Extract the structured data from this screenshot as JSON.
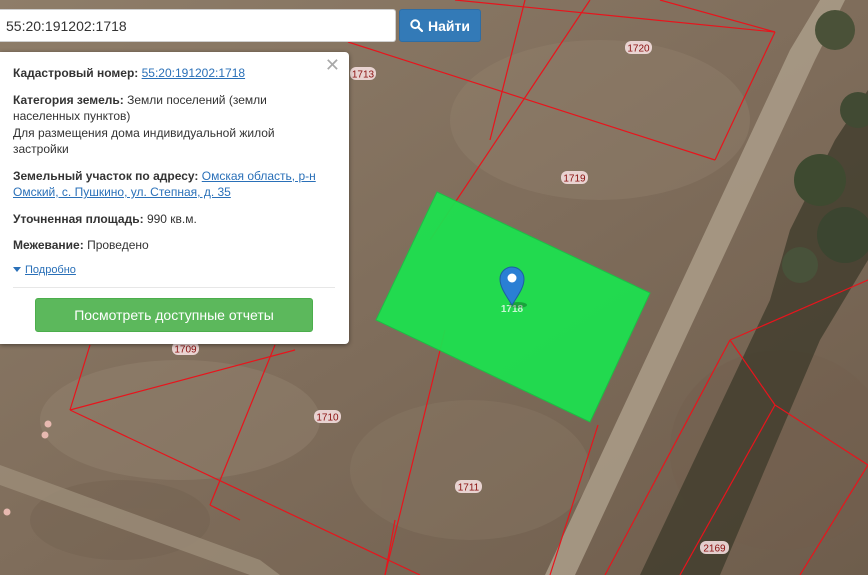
{
  "search": {
    "value": "55:20:191202:1718",
    "button_label": "Найти"
  },
  "popup": {
    "cadastral_label": "Кадастровый номер:",
    "cadastral_value": "55:20:191202:1718",
    "category_label": "Категория земель:",
    "category_value": "Земли поселений (земли населенных пунктов)",
    "category_use": "Для размещения дома индивидуальной жилой застройки",
    "address_label": "Земельный участок по адресу:",
    "address_value": "Омская область, р-н Омский, с. Пушкино, ул. Степная, д. 35",
    "area_label": "Уточненная площадь:",
    "area_value": "990 кв.м.",
    "survey_label": "Межевание:",
    "survey_value": "Проведено",
    "details_link": "Подробно",
    "reports_button": "Посмотреть доступные отчеты",
    "close_symbol": "✕"
  },
  "map": {
    "selected_parcel": "1718",
    "parcel_labels": [
      "1713",
      "1720",
      "1719",
      "1709",
      "1710",
      "1711",
      "2169"
    ],
    "colors": {
      "boundary": "#e8141c",
      "selected_fill": "#1ee04f",
      "marker": "#2a7fd4",
      "label_bg": "#f4dede",
      "label_text": "#8a1010"
    }
  }
}
